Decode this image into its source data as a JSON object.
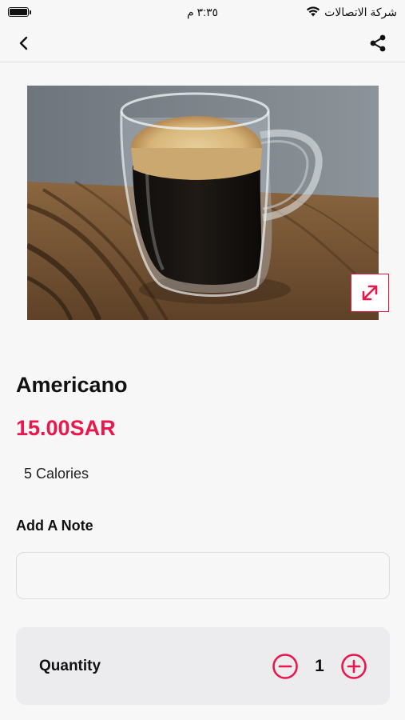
{
  "status_bar": {
    "carrier": "شركة الاتصالات",
    "time": "٣:٣٥ م",
    "battery_level": 1.0
  },
  "nav": {
    "back_icon": "chevron-left-icon",
    "share_icon": "share-icon"
  },
  "product": {
    "image_subject": "americano-coffee-glass-mug",
    "expand_icon": "expand-arrows-icon",
    "name": "Americano",
    "price": "15.00SAR",
    "calories": "5 Calories"
  },
  "note": {
    "label": "Add A Note",
    "value": "",
    "placeholder": ""
  },
  "quantity": {
    "label": "Quantity",
    "value": "1",
    "minus_icon": "minus-circle-icon",
    "plus_icon": "plus-circle-icon"
  },
  "colors": {
    "accent": "#e8174c",
    "background": "#f7f7f7",
    "card": "#ececef"
  }
}
